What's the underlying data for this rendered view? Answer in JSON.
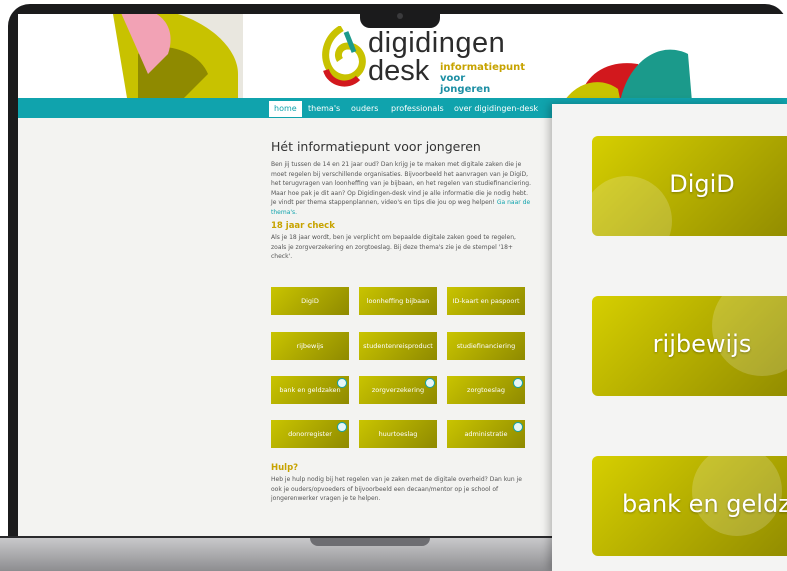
{
  "logo": {
    "word1": "digidingen",
    "word2": "desk",
    "tag1": "informatiepunt",
    "tag2": "voor jongeren"
  },
  "nav": {
    "items": [
      "home",
      "thema's",
      "ouders",
      "professionals",
      "over digidingen-desk"
    ],
    "active": "home"
  },
  "main": {
    "title": "Hét informatiepunt voor jongeren",
    "intro": "Ben jij tussen de 14 en 21 jaar oud? Dan krijg je te maken met digitale zaken die je moet regelen bij verschillende organisaties. Bijvoorbeeld het aanvragen van je DigiD, het terugvragen van loonheffing van je bijbaan, en het regelen van studiefinanciering. Maar hoe pak je dit aan? Op Digidingen-desk vind je alle informatie die je nodig hebt. Je vindt per thema stappenplannen, video's en tips die jou op weg helpen!",
    "intro_link": "Ga naar de thema's.",
    "check_title": "18 jaar check",
    "check_text": "Als je 18 jaar wordt, ben je verplicht om bepaalde digitale zaken goed te regelen, zoals je zorgverzekering en zorgtoeslag. Bij deze thema's zie je de stempel '18+ check'.",
    "help_title": "Hulp?",
    "help_text": "Heb je hulp nodig bij het regelen van je zaken met de digitale overheid? Dan kun je ook je ouders/opvoeders of bijvoorbeeld een decaan/mentor op je school of jongerenwerker vragen je te helpen."
  },
  "tiles": [
    "DigiD",
    "loonheffing bijbaan",
    "ID-kaart en paspoort",
    "rijbewijs",
    "studentenreisproduct",
    "studiefinanciering",
    "bank en geldzaken",
    "zorgverzekering",
    "zorgtoeslag",
    "donorregister",
    "huurtoeslag",
    "administratie"
  ],
  "panel": {
    "cards": [
      "DigiD",
      "rijbewijs",
      "bank en geldza"
    ]
  },
  "colors": {
    "teal": "#10a3ad",
    "olive": "#b8b200",
    "mustard": "#c7a300"
  }
}
